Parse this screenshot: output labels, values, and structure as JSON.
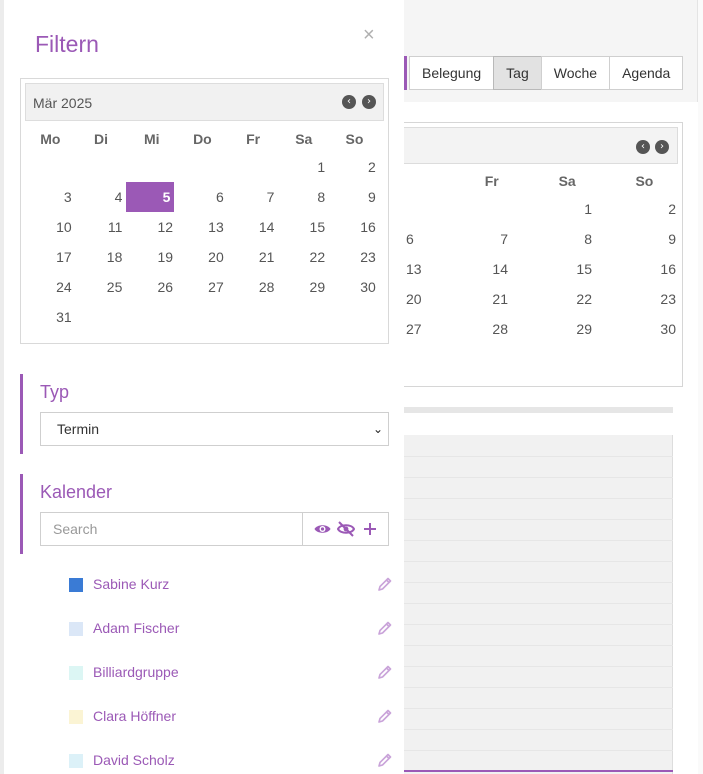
{
  "background": {
    "view_buttons": [
      {
        "label": "Belegung",
        "active": false
      },
      {
        "label": "Tag",
        "active": true
      },
      {
        "label": "Woche",
        "active": false
      },
      {
        "label": "Agenda",
        "active": false
      }
    ],
    "calendar": {
      "headers": [
        "Fr",
        "Sa",
        "So"
      ],
      "rows": [
        [
          "",
          "",
          "1",
          "2"
        ],
        [
          "6",
          "7",
          "8",
          "9"
        ],
        [
          "13",
          "14",
          "15",
          "16"
        ],
        [
          "20",
          "21",
          "22",
          "23"
        ],
        [
          "27",
          "28",
          "29",
          "30"
        ]
      ]
    }
  },
  "filter_panel": {
    "title": "Filtern",
    "close_symbol": "×",
    "mini_calendar": {
      "month_label": "Mär 2025",
      "weekday_headers": [
        "Mo",
        "Di",
        "Mi",
        "Do",
        "Fr",
        "Sa",
        "So"
      ],
      "weeks": [
        [
          "",
          "",
          "",
          "",
          "",
          "1",
          "2"
        ],
        [
          "3",
          "4",
          "5",
          "6",
          "7",
          "8",
          "9"
        ],
        [
          "10",
          "11",
          "12",
          "13",
          "14",
          "15",
          "16"
        ],
        [
          "17",
          "18",
          "19",
          "20",
          "21",
          "22",
          "23"
        ],
        [
          "24",
          "25",
          "26",
          "27",
          "28",
          "29",
          "30"
        ],
        [
          "31",
          "",
          "",
          "",
          "",
          "",
          ""
        ]
      ],
      "selected_day": "5",
      "accent_color": "#9b59b6"
    },
    "typ": {
      "title": "Typ",
      "selected": "Termin"
    },
    "kalender": {
      "title": "Kalender",
      "search_placeholder": "Search",
      "items": [
        {
          "name": "Sabine Kurz",
          "color": "#3a7bd5"
        },
        {
          "name": "Adam Fischer",
          "color": "#dbe7f7"
        },
        {
          "name": "Billiardgruppe",
          "color": "#dcf6f4"
        },
        {
          "name": "Clara Höffner",
          "color": "#fbf4d4"
        },
        {
          "name": "David Scholz",
          "color": "#dcf1f8"
        }
      ]
    }
  }
}
